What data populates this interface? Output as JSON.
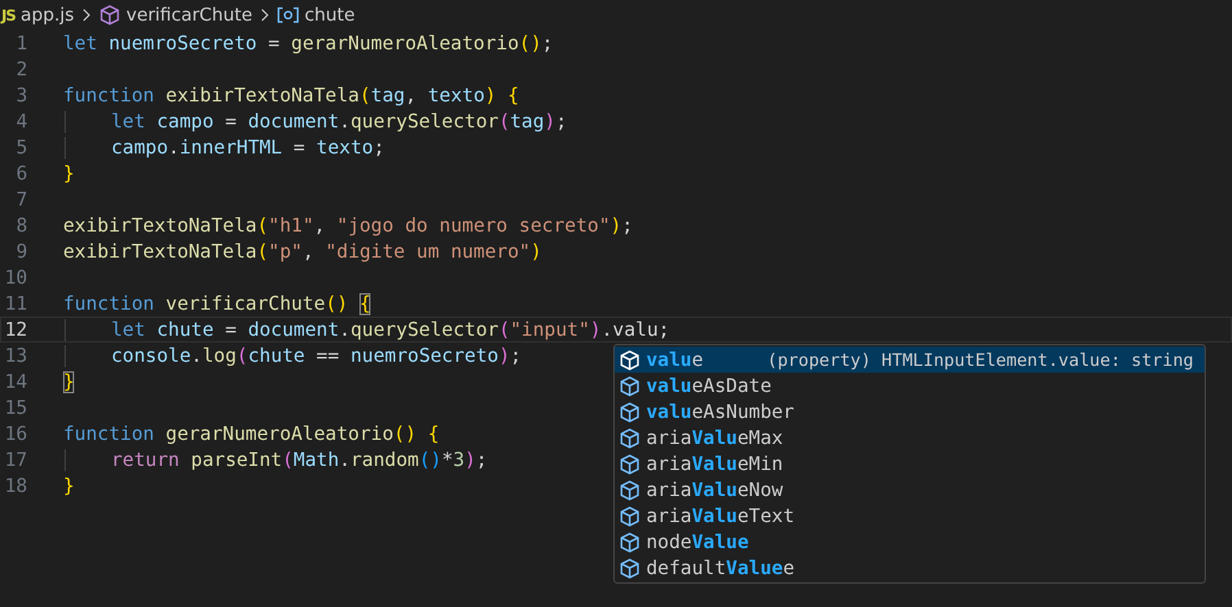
{
  "breadcrumb": {
    "file_badge": "JS",
    "file": "app.js",
    "function": "verificarChute",
    "variable": "chute"
  },
  "editor": {
    "lines": [
      {
        "number": "1",
        "current": false,
        "indent": false,
        "tokens": [
          {
            "text": "let",
            "kind": "keyword"
          },
          {
            "text": " nuemroSecreto",
            "kind": "variable"
          },
          {
            "text": " = ",
            "kind": "punct"
          },
          {
            "text": "gerarNumeroAleatorio",
            "kind": "function"
          },
          {
            "text": "()",
            "kind": "bracket1"
          },
          {
            "text": ";",
            "kind": "punct"
          }
        ]
      },
      {
        "number": "2",
        "current": false
      },
      {
        "number": "3",
        "current": false,
        "indent": false,
        "tokens": [
          {
            "text": "function",
            "kind": "keyword"
          },
          {
            "text": " exibirTextoNaTela",
            "kind": "function"
          },
          {
            "text": "(",
            "kind": "bracket1"
          },
          {
            "text": "tag",
            "kind": "variable"
          },
          {
            "text": ", ",
            "kind": "punct"
          },
          {
            "text": "texto",
            "kind": "variable"
          },
          {
            "text": ")",
            "kind": "bracket1"
          },
          {
            "text": " {",
            "kind": "bracket1"
          }
        ]
      },
      {
        "number": "4",
        "current": false,
        "indent": true,
        "tokens": [
          {
            "text": "let",
            "kind": "keyword"
          },
          {
            "text": " campo",
            "kind": "variable"
          },
          {
            "text": " = ",
            "kind": "punct"
          },
          {
            "text": "document",
            "kind": "variable"
          },
          {
            "text": ".",
            "kind": "punct"
          },
          {
            "text": "querySelector",
            "kind": "function"
          },
          {
            "text": "(",
            "kind": "bracket2"
          },
          {
            "text": "tag",
            "kind": "variable"
          },
          {
            "text": ")",
            "kind": "bracket2"
          },
          {
            "text": ";",
            "kind": "punct"
          }
        ]
      },
      {
        "number": "5",
        "current": false,
        "indent": true,
        "tokens": [
          {
            "text": "campo",
            "kind": "variable"
          },
          {
            "text": ".",
            "kind": "punct"
          },
          {
            "text": "innerHTML",
            "kind": "variable"
          },
          {
            "text": " = ",
            "kind": "punct"
          },
          {
            "text": "texto",
            "kind": "variable"
          },
          {
            "text": ";",
            "kind": "punct"
          }
        ]
      },
      {
        "number": "6",
        "current": false,
        "indent": false,
        "tokens": [
          {
            "text": "}",
            "kind": "bracket1"
          }
        ]
      },
      {
        "number": "7",
        "current": false
      },
      {
        "number": "8",
        "current": false,
        "indent": false,
        "tokens": [
          {
            "text": "exibirTextoNaTela",
            "kind": "function"
          },
          {
            "text": "(",
            "kind": "bracket1"
          },
          {
            "text": "\"h1\"",
            "kind": "string"
          },
          {
            "text": ", ",
            "kind": "punct"
          },
          {
            "text": "\"jogo do numero secreto\"",
            "kind": "string"
          },
          {
            "text": ")",
            "kind": "bracket1"
          },
          {
            "text": ";",
            "kind": "punct"
          }
        ]
      },
      {
        "number": "9",
        "current": false,
        "indent": false,
        "tokens": [
          {
            "text": "exibirTextoNaTela",
            "kind": "function"
          },
          {
            "text": "(",
            "kind": "bracket1"
          },
          {
            "text": "\"p\"",
            "kind": "string"
          },
          {
            "text": ", ",
            "kind": "punct"
          },
          {
            "text": "\"digite um numero\"",
            "kind": "string"
          },
          {
            "text": ")",
            "kind": "bracket1"
          }
        ]
      },
      {
        "number": "10",
        "current": false
      },
      {
        "number": "11",
        "current": false,
        "indent": false,
        "tokens": [
          {
            "text": "function",
            "kind": "keyword"
          },
          {
            "text": " verificarChute",
            "kind": "function"
          },
          {
            "text": "() ",
            "kind": "bracket1"
          },
          {
            "text": "{",
            "kind": "bracket1",
            "matched": true
          }
        ]
      },
      {
        "number": "12",
        "current": true,
        "indent": true,
        "tokens": [
          {
            "text": "let",
            "kind": "keyword"
          },
          {
            "text": " chute",
            "kind": "variable"
          },
          {
            "text": " = ",
            "kind": "punct"
          },
          {
            "text": "document",
            "kind": "variable"
          },
          {
            "text": ".",
            "kind": "punct"
          },
          {
            "text": "querySelector",
            "kind": "function"
          },
          {
            "text": "(",
            "kind": "bracket2"
          },
          {
            "text": "\"input\"",
            "kind": "string"
          },
          {
            "text": ")",
            "kind": "bracket2"
          },
          {
            "text": ".valu;",
            "kind": "punct"
          }
        ]
      },
      {
        "number": "13",
        "current": false,
        "indent": true,
        "tokens": [
          {
            "text": "console",
            "kind": "variable"
          },
          {
            "text": ".",
            "kind": "punct"
          },
          {
            "text": "log",
            "kind": "function"
          },
          {
            "text": "(",
            "kind": "bracket2"
          },
          {
            "text": "chute",
            "kind": "variable"
          },
          {
            "text": " == ",
            "kind": "punct"
          },
          {
            "text": "nuemroSecreto",
            "kind": "variable"
          },
          {
            "text": ")",
            "kind": "bracket2"
          },
          {
            "text": ";",
            "kind": "punct"
          }
        ]
      },
      {
        "number": "14",
        "current": false,
        "indent": false,
        "tokens": [
          {
            "text": "}",
            "kind": "bracket1",
            "matched": true
          }
        ]
      },
      {
        "number": "15",
        "current": false
      },
      {
        "number": "16",
        "current": false,
        "indent": false,
        "tokens": [
          {
            "text": "function",
            "kind": "keyword"
          },
          {
            "text": " gerarNumeroAleatorio",
            "kind": "function"
          },
          {
            "text": "()",
            "kind": "bracket1"
          },
          {
            "text": " {",
            "kind": "bracket1"
          }
        ]
      },
      {
        "number": "17",
        "current": false,
        "indent": true,
        "tokens": [
          {
            "text": "return",
            "kind": "control"
          },
          {
            "text": " parseInt",
            "kind": "function"
          },
          {
            "text": "(",
            "kind": "bracket2"
          },
          {
            "text": "Math",
            "kind": "variable"
          },
          {
            "text": ".",
            "kind": "punct"
          },
          {
            "text": "random",
            "kind": "function"
          },
          {
            "text": "()",
            "kind": "bracket3"
          },
          {
            "text": "*",
            "kind": "punct"
          },
          {
            "text": "3",
            "kind": "number"
          },
          {
            "text": ")",
            "kind": "bracket2"
          },
          {
            "text": ";",
            "kind": "punct"
          }
        ]
      },
      {
        "number": "18",
        "current": false,
        "indent": false,
        "tokens": [
          {
            "text": "}",
            "kind": "bracket1"
          }
        ]
      }
    ]
  },
  "suggestions": {
    "items": [
      {
        "selected": true,
        "parts": [
          {
            "text": "valu",
            "match": true
          },
          {
            "text": "e",
            "match": false
          }
        ],
        "detail": "(property) HTMLInputElement.value: string"
      },
      {
        "selected": false,
        "parts": [
          {
            "text": "valu",
            "match": true
          },
          {
            "text": "eAsDate",
            "match": false
          }
        ]
      },
      {
        "selected": false,
        "parts": [
          {
            "text": "valu",
            "match": true
          },
          {
            "text": "eAsNumber",
            "match": false
          }
        ]
      },
      {
        "selected": false,
        "parts": [
          {
            "text": "aria",
            "match": false
          },
          {
            "text": "Valu",
            "match": true
          },
          {
            "text": "eMax",
            "match": false
          }
        ]
      },
      {
        "selected": false,
        "parts": [
          {
            "text": "aria",
            "match": false
          },
          {
            "text": "Valu",
            "match": true
          },
          {
            "text": "eMin",
            "match": false
          }
        ]
      },
      {
        "selected": false,
        "parts": [
          {
            "text": "aria",
            "match": false
          },
          {
            "text": "Valu",
            "match": true
          },
          {
            "text": "eNow",
            "match": false
          }
        ]
      },
      {
        "selected": false,
        "parts": [
          {
            "text": "aria",
            "match": false
          },
          {
            "text": "Valu",
            "match": true
          },
          {
            "text": "eText",
            "match": false
          }
        ]
      },
      {
        "selected": false,
        "parts": [
          {
            "text": "node",
            "match": false
          },
          {
            "text": "Value",
            "match": true
          }
        ]
      },
      {
        "selected": false,
        "parts": [
          {
            "text": "default",
            "match": false
          },
          {
            "text": "Value",
            "match": true
          },
          {
            "text": "e",
            "match": false
          }
        ]
      }
    ]
  }
}
